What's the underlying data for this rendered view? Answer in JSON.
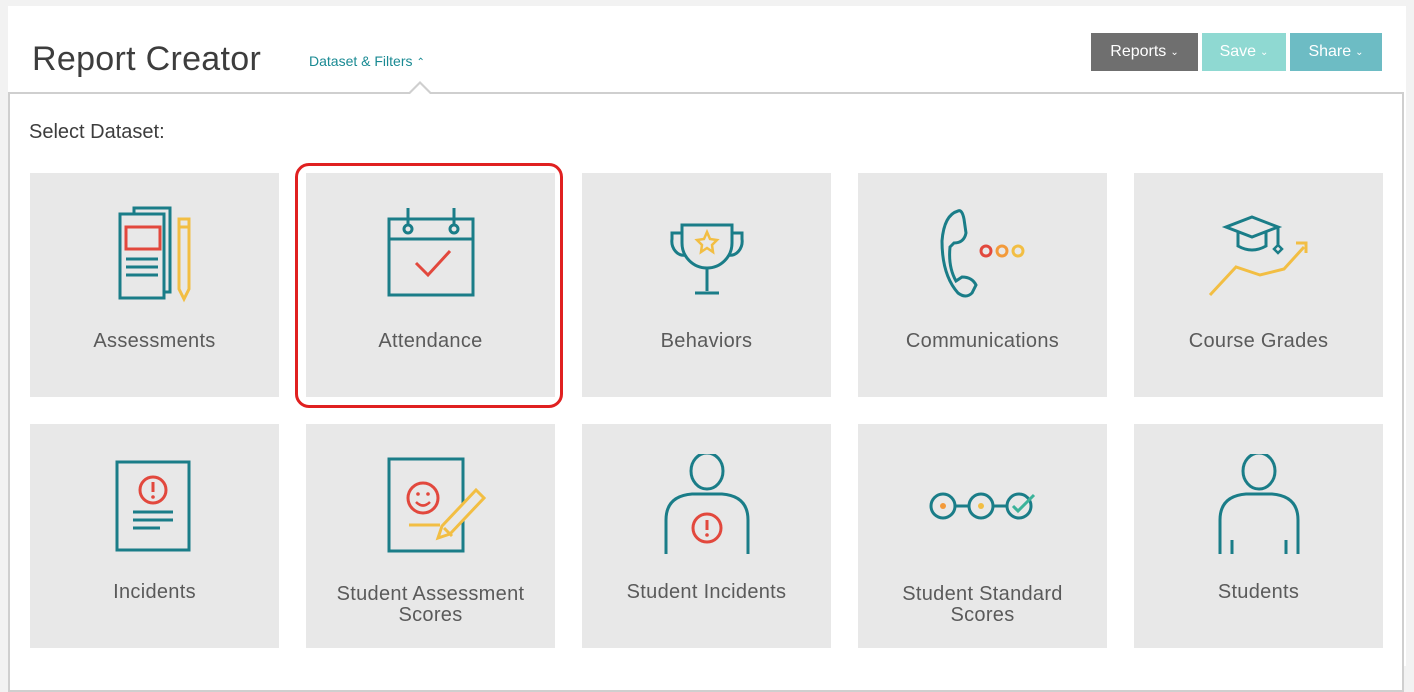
{
  "header": {
    "title": "Report Creator",
    "dataset_link": "Dataset & Filters",
    "buttons": {
      "reports": "Reports",
      "save": "Save",
      "share": "Share"
    }
  },
  "panel": {
    "select_label": "Select Dataset:"
  },
  "datasets": [
    {
      "label": "Assessments",
      "icon": "assessments-icon"
    },
    {
      "label": "Attendance",
      "icon": "calendar-check-icon",
      "selected": true
    },
    {
      "label": "Behaviors",
      "icon": "trophy-icon"
    },
    {
      "label": "Communications",
      "icon": "phone-icon"
    },
    {
      "label": "Course Grades",
      "icon": "graduation-chart-icon"
    },
    {
      "label": "Incidents",
      "icon": "incident-document-icon"
    },
    {
      "label": "Student Assessment Scores",
      "icon": "smiley-document-icon"
    },
    {
      "label": "Student Incidents",
      "icon": "student-alert-icon"
    },
    {
      "label": "Student Standard Scores",
      "icon": "progress-dots-icon"
    },
    {
      "label": "Students",
      "icon": "student-icon"
    }
  ],
  "colors": {
    "teal": "#1a7d88",
    "red": "#e2483d",
    "yellow": "#f2be43",
    "orange": "#f39a3a",
    "green": "#3bb39a"
  }
}
